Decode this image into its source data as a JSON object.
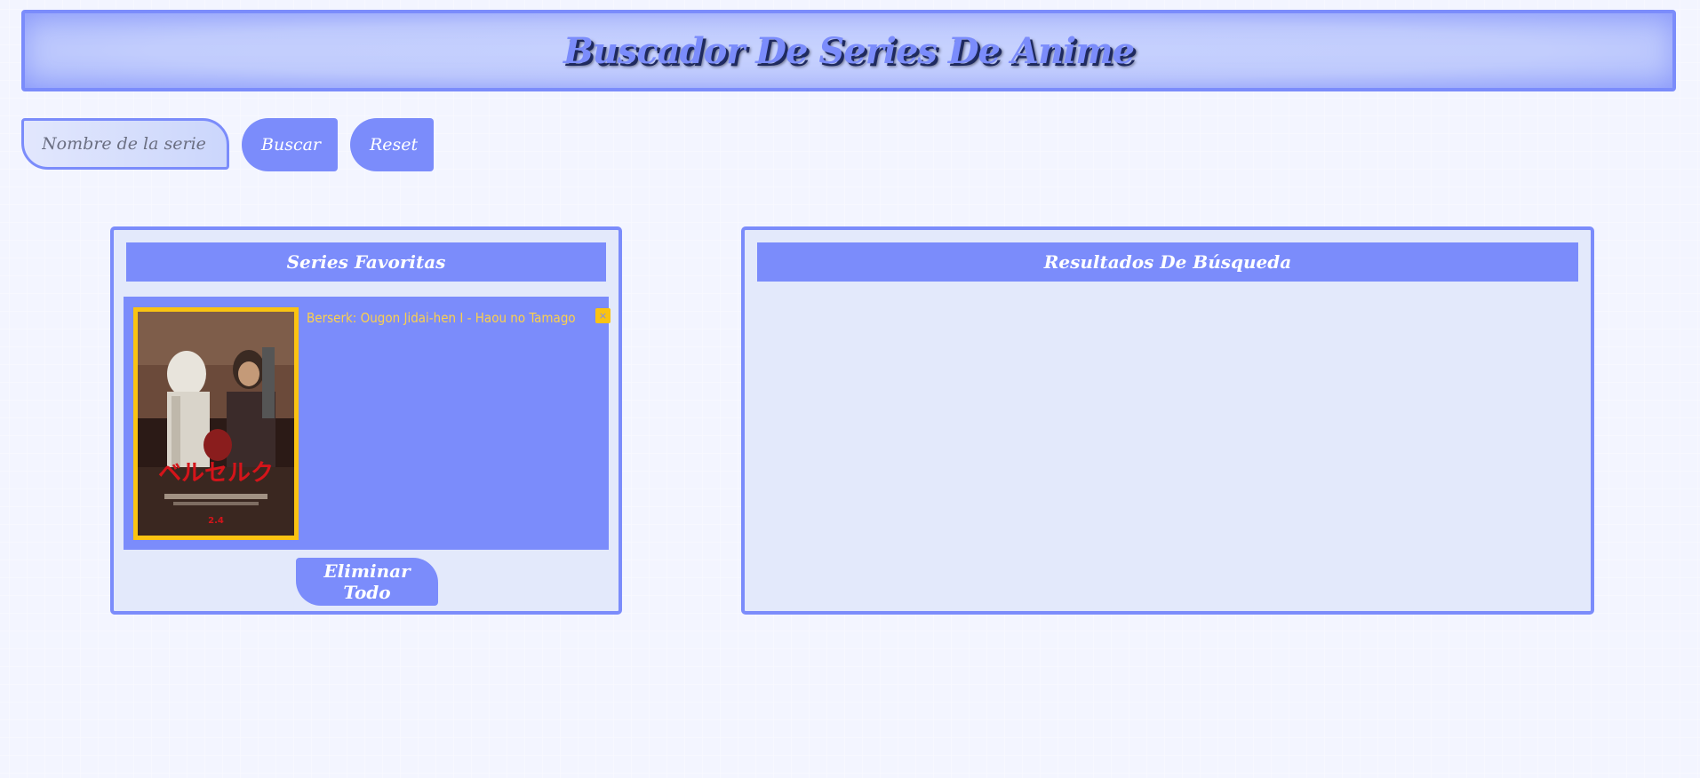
{
  "header": {
    "title": "Buscador De Series De Anime"
  },
  "search": {
    "placeholder": "Nombre de la serie",
    "value": "",
    "search_label": "Buscar",
    "reset_label": "Reset"
  },
  "favorites": {
    "title": "Series Favoritas",
    "items": [
      {
        "name": "Berserk: Ougon Jidai-hen I - Haou no Tamago",
        "remove_label": "×",
        "poster_icon": "anime-poster-image"
      }
    ],
    "delete_all_label": "Eliminar Todo"
  },
  "results": {
    "title": "Resultados De Búsqueda",
    "items": []
  },
  "colors": {
    "accent": "#7b8cfb",
    "background": "#c3cffd",
    "panel": "#e3e9fb",
    "highlight": "#fac312"
  }
}
